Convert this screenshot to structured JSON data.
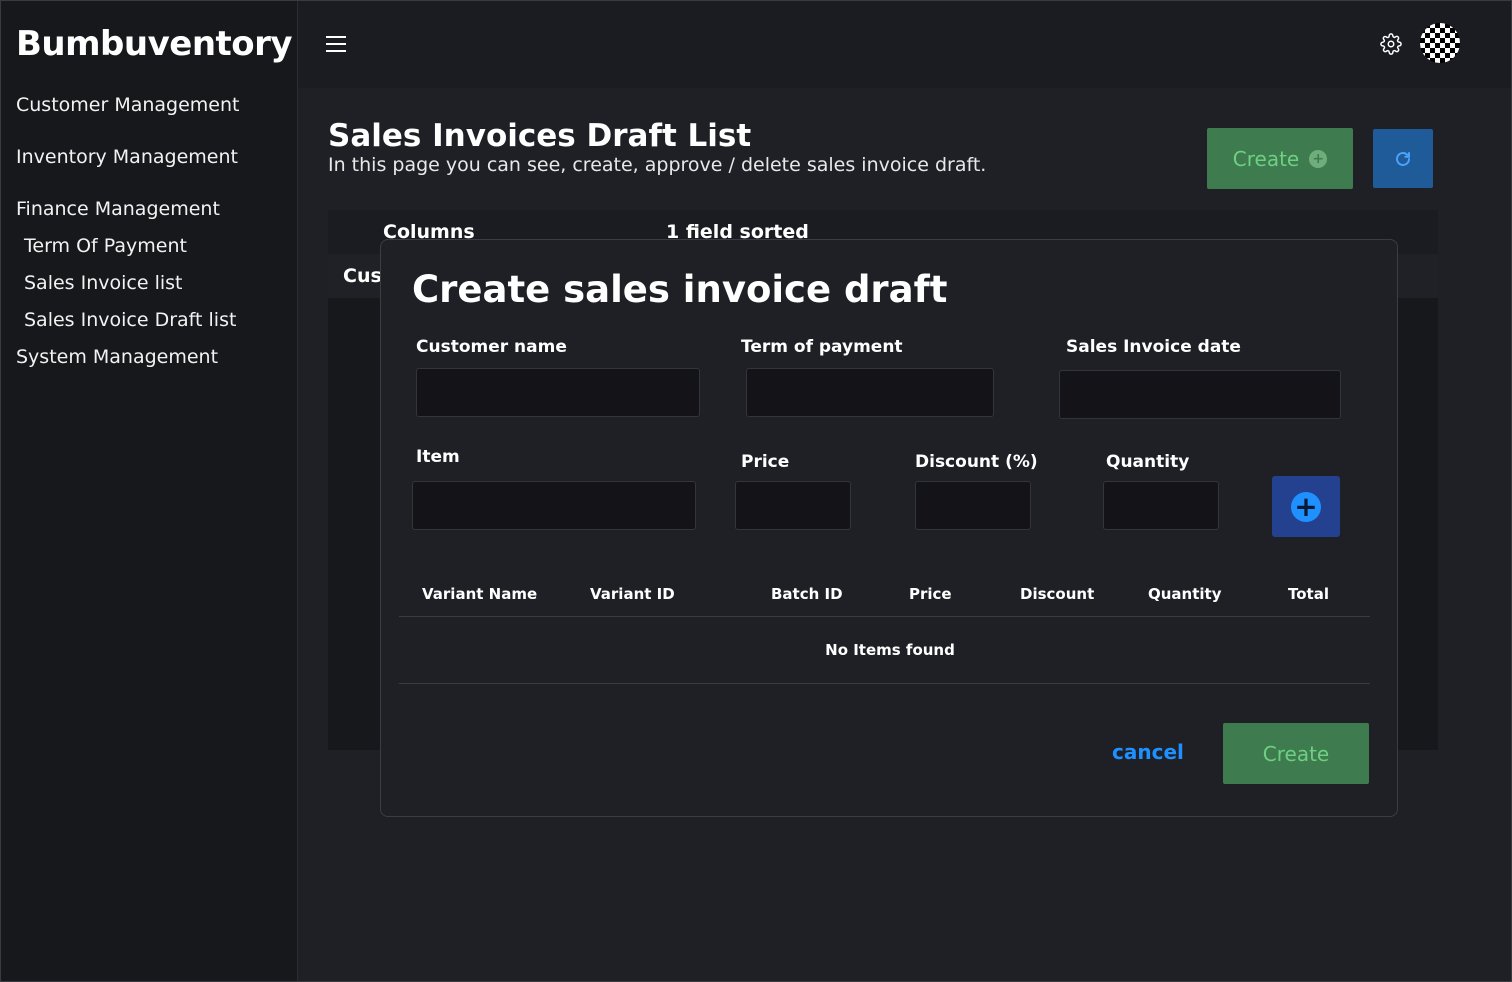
{
  "app": {
    "brand": "Bumbuventory"
  },
  "sidebar": {
    "items": [
      {
        "label": "Customer Management"
      },
      {
        "label": "Inventory Management"
      },
      {
        "label": "Finance Management"
      },
      {
        "label": "Term Of Payment"
      },
      {
        "label": "Sales Invoice list"
      },
      {
        "label": "Sales Invoice Draft list"
      },
      {
        "label": "System Management"
      }
    ]
  },
  "topbar": {
    "menu_icon": "hamburger-icon",
    "settings_icon": "gear-icon",
    "avatar": "checkered-avatar"
  },
  "page": {
    "title": "Sales Invoices Draft List",
    "subtitle": "In this page you can see, create, approve / delete sales invoice draft.",
    "create_label": "Create",
    "create_icon": "plus-circle-icon",
    "refresh_icon": "refresh-icon"
  },
  "background_table": {
    "toolbar_columns": "Columns",
    "toolbar_sorted": "1 field sorted",
    "first_header": "Cus"
  },
  "modal": {
    "title": "Create sales invoice draft",
    "fields": {
      "customer_name": {
        "label": "Customer name",
        "value": ""
      },
      "term_of_payment": {
        "label": "Term of payment",
        "value": ""
      },
      "sales_invoice_date": {
        "label": "Sales Invoice date",
        "value": ""
      },
      "item": {
        "label": "Item",
        "value": ""
      },
      "price": {
        "label": "Price",
        "value": ""
      },
      "discount": {
        "label": "Discount (%)",
        "value": ""
      },
      "quantity": {
        "label": "Quantity",
        "value": ""
      }
    },
    "add_icon": "plus-circle-icon",
    "table": {
      "columns": [
        "Variant Name",
        "Variant ID",
        "Batch ID",
        "Price",
        "Discount",
        "Quantity",
        "Total"
      ],
      "rows": [],
      "empty_message": "No Items found"
    },
    "cancel_label": "cancel",
    "create_label": "Create"
  },
  "colors": {
    "background": "#1f2026",
    "sidebar": "#17181c",
    "create_button": "#3e7b4f",
    "create_text": "#6fcf83",
    "refresh_button": "#1f5a99",
    "add_button": "#24418f",
    "link_blue": "#1e90ff"
  }
}
